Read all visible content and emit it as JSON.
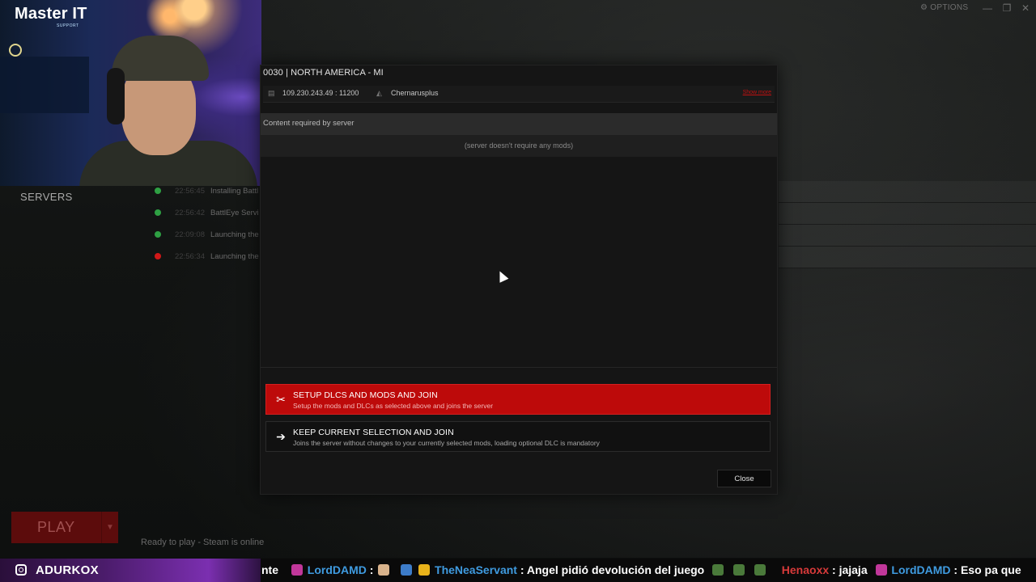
{
  "webcam": {
    "logo_title": "Master IT",
    "logo_sub": "SUPPORT"
  },
  "launcher": {
    "options_label": "OPTIONS",
    "nav_servers": "SERVERS",
    "log": [
      {
        "time": "22:56:45",
        "message": "Installing Battl",
        "status": "ok"
      },
      {
        "time": "22:56:42",
        "message": "BattlEye Servi",
        "status": "ok"
      },
      {
        "time": "22:09:08",
        "message": "Launching the",
        "status": "ok"
      },
      {
        "time": "22:56:34",
        "message": "Launching the",
        "status": "error"
      }
    ],
    "play_label": "PLAY",
    "status_text": "Ready to play - Steam is online"
  },
  "modal": {
    "server_title": "0030 | NORTH AMERICA - MI",
    "server_ip": "109.230.243.49 : 11200",
    "server_map": "Chernarusplus",
    "show_more": "Show more",
    "content_header": "Content required by server",
    "content_empty": "(server doesn't require any mods)",
    "setup_title": "SETUP DLCS AND MODS AND JOIN",
    "setup_sub": "Setup the mods and DLCs as selected above and joins the server",
    "keep_title": "KEEP CURRENT SELECTION AND JOIN",
    "keep_sub": "Joins the server without changes to your currently selected mods, loading optional DLC is mandatory",
    "close_label": "Close"
  },
  "ticker": {
    "brand": "ADURKOX",
    "fragment": "nte",
    "user1": "LordDAMD",
    "user2": "TheNeaServant",
    "msg2": ": Angel pidió devolución del juego",
    "user3": "Henaoxx",
    "msg3": ": jajaja",
    "user4": "LordDAMD",
    "msg4": ": Eso pa que"
  },
  "colors": {
    "accent_red": "#bd0a0a",
    "ok_green": "#2ea043",
    "error_red": "#d01818",
    "chat_blue": "#3f9be0"
  }
}
